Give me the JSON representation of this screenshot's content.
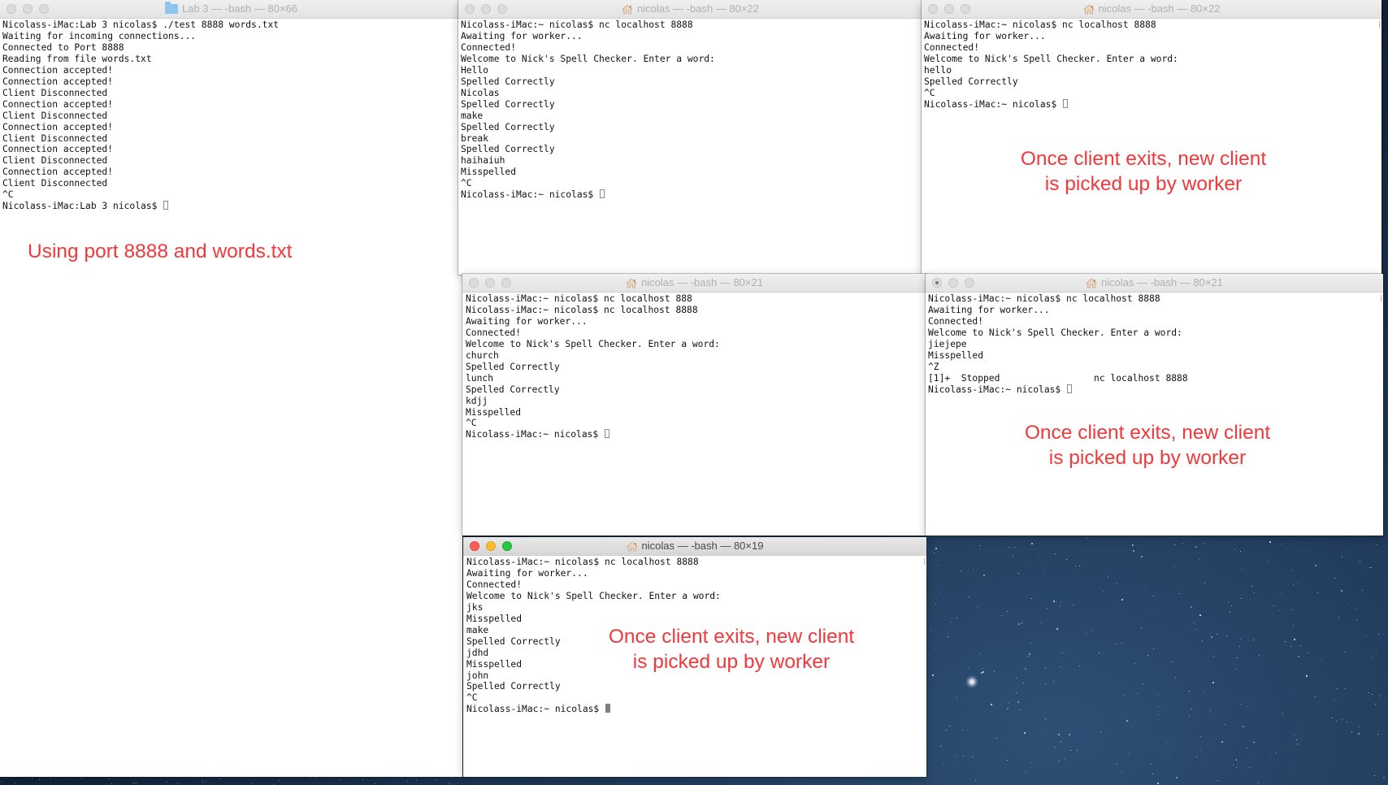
{
  "windows": [
    {
      "title": "Lab 3 — -bash — 80×66",
      "lines": [
        "Nicolass-iMac:Lab 3 nicolas$ ./test 8888 words.txt",
        "Waiting for incoming connections...",
        "Connected to Port 8888",
        "Reading from file words.txt",
        "Connection accepted!",
        "Connection accepted!",
        "Client Disconnected",
        "Connection accepted!",
        "Client Disconnected",
        "Connection accepted!",
        "Client Disconnected",
        "Connection accepted!",
        "Client Disconnected",
        "Connection accepted!",
        "Client Disconnected",
        "^C"
      ],
      "prompt": "Nicolass-iMac:Lab 3 nicolas$ "
    },
    {
      "title": "nicolas — -bash — 80×22",
      "lines": [
        "Nicolass-iMac:~ nicolas$ nc localhost 8888",
        "Awaiting for worker...",
        "Connected!",
        "Welcome to Nick's Spell Checker. Enter a word:",
        "Hello",
        "Spelled Correctly",
        "Nicolas",
        "Spelled Correctly",
        "make",
        "Spelled Correctly",
        "break",
        "Spelled Correctly",
        "haihaiuh",
        "Misspelled",
        "^C"
      ],
      "prompt": "Nicolass-iMac:~ nicolas$ "
    },
    {
      "title": "nicolas — -bash — 80×22",
      "lines": [
        "Nicolass-iMac:~ nicolas$ nc localhost 8888",
        "Awaiting for worker...",
        "Connected!",
        "Welcome to Nick's Spell Checker. Enter a word:",
        "hello",
        "Spelled Correctly",
        "^C"
      ],
      "prompt": "Nicolass-iMac:~ nicolas$ "
    },
    {
      "title": "nicolas — -bash — 80×21",
      "lines": [
        "Nicolass-iMac:~ nicolas$ nc localhost 888",
        "Nicolass-iMac:~ nicolas$ nc localhost 8888",
        "Awaiting for worker...",
        "Connected!",
        "Welcome to Nick's Spell Checker. Enter a word:",
        "church",
        "Spelled Correctly",
        "lunch",
        "Spelled Correctly",
        "kdjj",
        "Misspelled",
        "^C"
      ],
      "prompt": "Nicolass-iMac:~ nicolas$ "
    },
    {
      "title": "nicolas — -bash — 80×21",
      "lines": [
        "Nicolass-iMac:~ nicolas$ nc localhost 8888",
        "Awaiting for worker...",
        "Connected!",
        "Welcome to Nick's Spell Checker. Enter a word:",
        "jiejepe",
        "Misspelled",
        "^Z",
        "[1]+  Stopped                 nc localhost 8888"
      ],
      "prompt": "Nicolass-iMac:~ nicolas$ "
    },
    {
      "title": "nicolas — -bash — 80×19",
      "lines": [
        "Nicolass-iMac:~ nicolas$ nc localhost 8888",
        "Awaiting for worker...",
        "Connected!",
        "Welcome to Nick's Spell Checker. Enter a word:",
        "jks",
        "Misspelled",
        "make",
        "Spelled Correctly",
        "jdhd",
        "Misspelled",
        "john",
        "Spelled Correctly",
        "^C"
      ],
      "prompt": "Nicolass-iMac:~ nicolas$ "
    }
  ],
  "annotations": {
    "server": "Using port 8888 and words.txt",
    "client_1_line_1": "Once client exits, new client",
    "client_1_line_2": "is picked up by worker",
    "client_2_line_1": "Once client exits, new client",
    "client_2_line_2": "is picked up by worker",
    "client_3_line_1": "Once client exits, new client",
    "client_3_line_2": "is picked up by worker"
  },
  "colors": {
    "annotation": "#f2383a",
    "close": "#fc5f57",
    "minimize": "#fdbc2e",
    "zoom": "#28c840"
  },
  "icons": {
    "server_window": "folder-icon",
    "client_windows": "home-icon"
  }
}
